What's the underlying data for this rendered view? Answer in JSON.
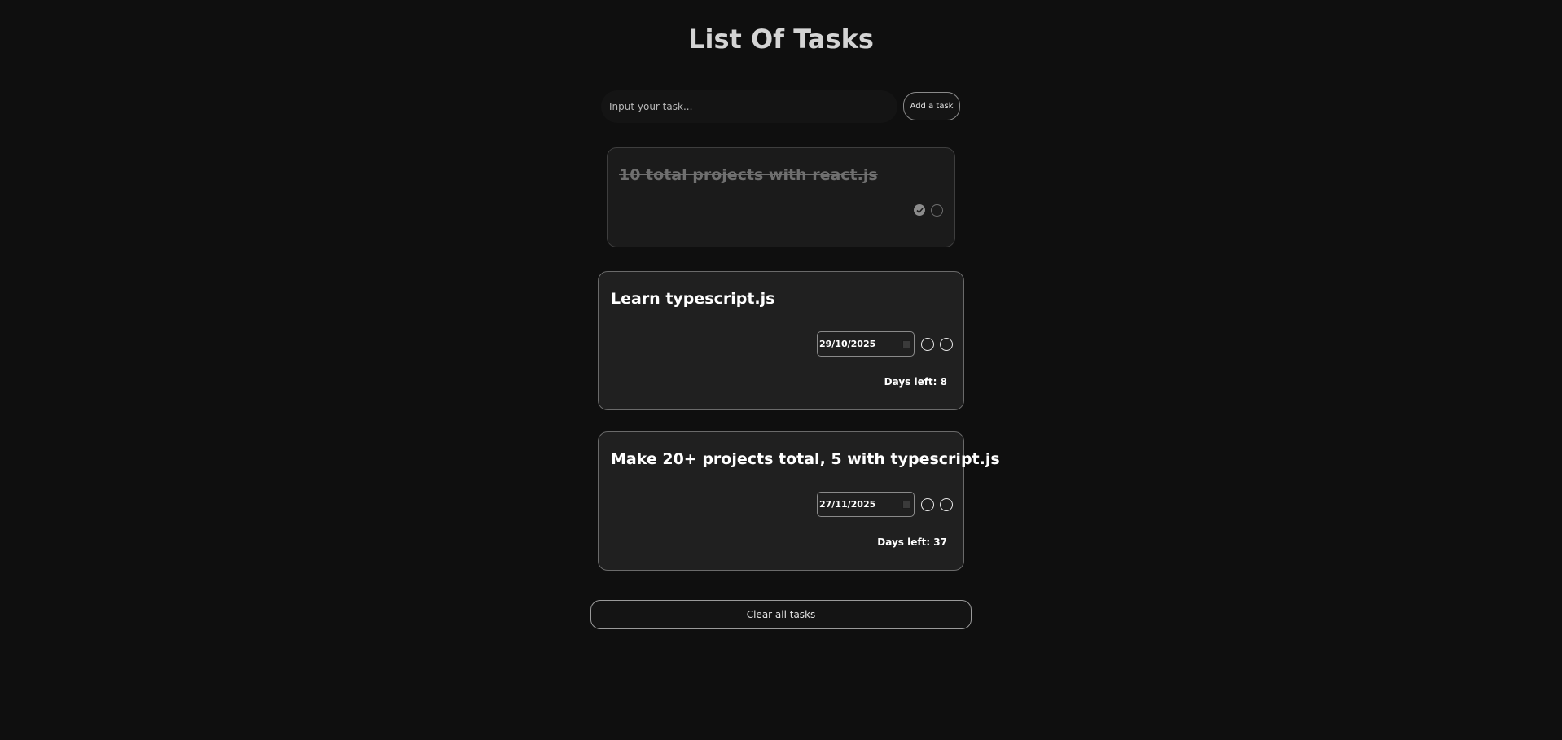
{
  "header": {
    "title": "List Of Tasks"
  },
  "input": {
    "placeholder": "Input your task...",
    "add_button_label": "Add a task"
  },
  "tasks": [
    {
      "title": "10 total projects with react.js",
      "completed": true
    },
    {
      "title": "Learn typescript.js",
      "completed": false,
      "due_date": "29/10/2025",
      "days_left_text": "Days left: 8"
    },
    {
      "title": "Make 20+ projects total, 5 with typescript.js",
      "completed": false,
      "due_date": "27/11/2025",
      "days_left_text": "Days left: 37"
    }
  ],
  "footer": {
    "clear_button_label": "Clear all tasks"
  },
  "colors": {
    "background": "#0f0f0f",
    "card": "#202020",
    "text": "#ffffff",
    "muted": "#6f6f6f"
  }
}
